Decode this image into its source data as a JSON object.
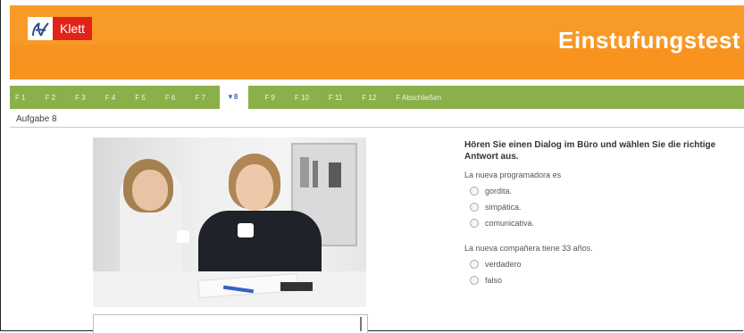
{
  "header": {
    "brand": "Klett",
    "title": "Einstufungstest",
    "logo_icon": "klett-logo-icon",
    "accent_color": "#f7931e",
    "brand_color": "#e2231a"
  },
  "nav": {
    "tabs": [
      {
        "label": "F 1",
        "active": false
      },
      {
        "label": "F 2",
        "active": false
      },
      {
        "label": "F 3",
        "active": false
      },
      {
        "label": "F 4",
        "active": false
      },
      {
        "label": "F 5",
        "active": false
      },
      {
        "label": "F 6",
        "active": false
      },
      {
        "label": "F 7",
        "active": false
      },
      {
        "label": "▼8",
        "active": true
      },
      {
        "label": "F 9",
        "active": false
      },
      {
        "label": "F 10",
        "active": false
      },
      {
        "label": "F 11",
        "active": false
      },
      {
        "label": "F 12",
        "active": false
      },
      {
        "label": "F Abschließen",
        "active": false
      }
    ],
    "color": "#8ab04a"
  },
  "page": {
    "heading": "Aufgabe 8"
  },
  "task": {
    "instruction": "Hören Sie einen Dialog im Büro und wählen Sie die richtige Antwort aus.",
    "question1": "La nueva programadora es",
    "options1": [
      "gordita.",
      "simpática.",
      "comunicativa."
    ],
    "question2": "La nueva compañera tiene 33 años.",
    "options2": [
      "verdadero",
      "falso"
    ]
  }
}
